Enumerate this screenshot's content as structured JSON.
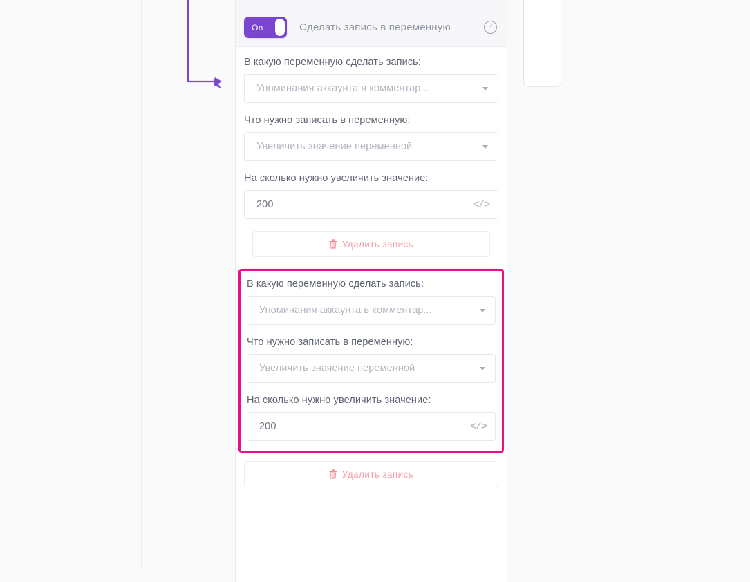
{
  "header": {
    "toggle_state": "On",
    "title": "Сделать запись в переменную",
    "help_icon": "question-mark-circle-icon",
    "accent_color": "#7a45cf"
  },
  "highlight": {
    "border_color": "#ec0f8c"
  },
  "connector": {
    "color": "#7b4ac9",
    "icon": "arrow-right-icon"
  },
  "blocks": [
    {
      "highlighted": false,
      "fields": [
        {
          "label": "В какую переменную сделать запись:",
          "type": "select",
          "value": "Упоминания аккаунта в комментар...",
          "filled": false
        },
        {
          "label": "Что нужно записать в переменную:",
          "type": "select",
          "value": "Увеличить значение переменной",
          "filled": false
        },
        {
          "label": "На сколько нужно увеличить значение:",
          "type": "input",
          "value": "200",
          "filled": true,
          "trailing_icon": "code-icon"
        }
      ],
      "delete_label": "Удалить запись",
      "delete_icon": "trash-icon"
    },
    {
      "highlighted": true,
      "fields": [
        {
          "label": "В какую переменную сделать запись:",
          "type": "select",
          "value": "Упоминания аккаунта в комментар...",
          "filled": false
        },
        {
          "label": "Что нужно записать в переменную:",
          "type": "select",
          "value": "Увеличить значение переменной",
          "filled": false
        },
        {
          "label": "На сколько нужно увеличить значение:",
          "type": "input",
          "value": "200",
          "filled": true,
          "trailing_icon": "code-icon"
        }
      ],
      "delete_label": "Удалить запись",
      "delete_icon": "trash-icon"
    }
  ]
}
